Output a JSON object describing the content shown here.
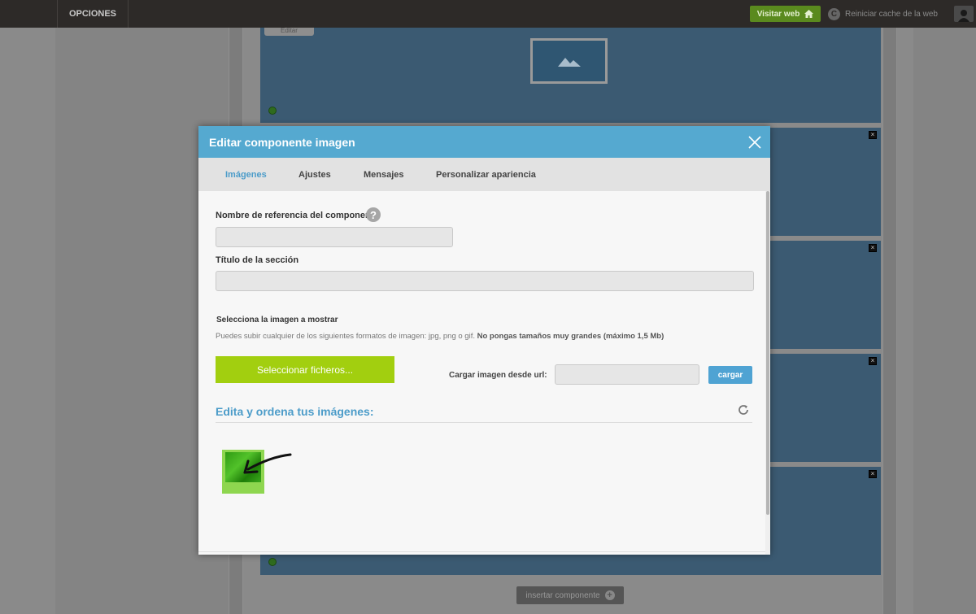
{
  "topbar": {
    "options_label": "OPCIONES",
    "visit_label": "Visitar web",
    "reset_label": "Reiniciar cache de la web"
  },
  "canvas": {
    "edit_tab_label": "Editar",
    "insert_label": "insertar componente"
  },
  "modal": {
    "title": "Editar componente imagen",
    "tabs": [
      {
        "label": "Imágenes",
        "active": true
      },
      {
        "label": "Ajustes",
        "active": false
      },
      {
        "label": "Mensajes",
        "active": false
      },
      {
        "label": "Personalizar apariencia",
        "active": false
      }
    ],
    "ref_name_label": "Nombre de referencia del componente",
    "ref_name_value": "",
    "section_title_label": "Título de la sección",
    "section_title_value": "",
    "select_image_label": "Selecciona la imagen a mostrar",
    "hint_text": "Puedes subir cualquier de los siguientes formatos de imagen: jpg, png o gif.",
    "hint_bold": "No pongas tamaños muy grandes (máximo 1,5 Mb)",
    "select_files_label": "Seleccionar ficheros...",
    "url_label": "Cargar imagen desde url:",
    "url_value": "",
    "load_label": "cargar",
    "images_title": "Edita y ordena tus imágenes:"
  },
  "colors": {
    "header": "#55a9d0",
    "accent": "#4c9cc9",
    "select_button": "#a2cf0f",
    "visit_button": "#5a8a1e"
  }
}
